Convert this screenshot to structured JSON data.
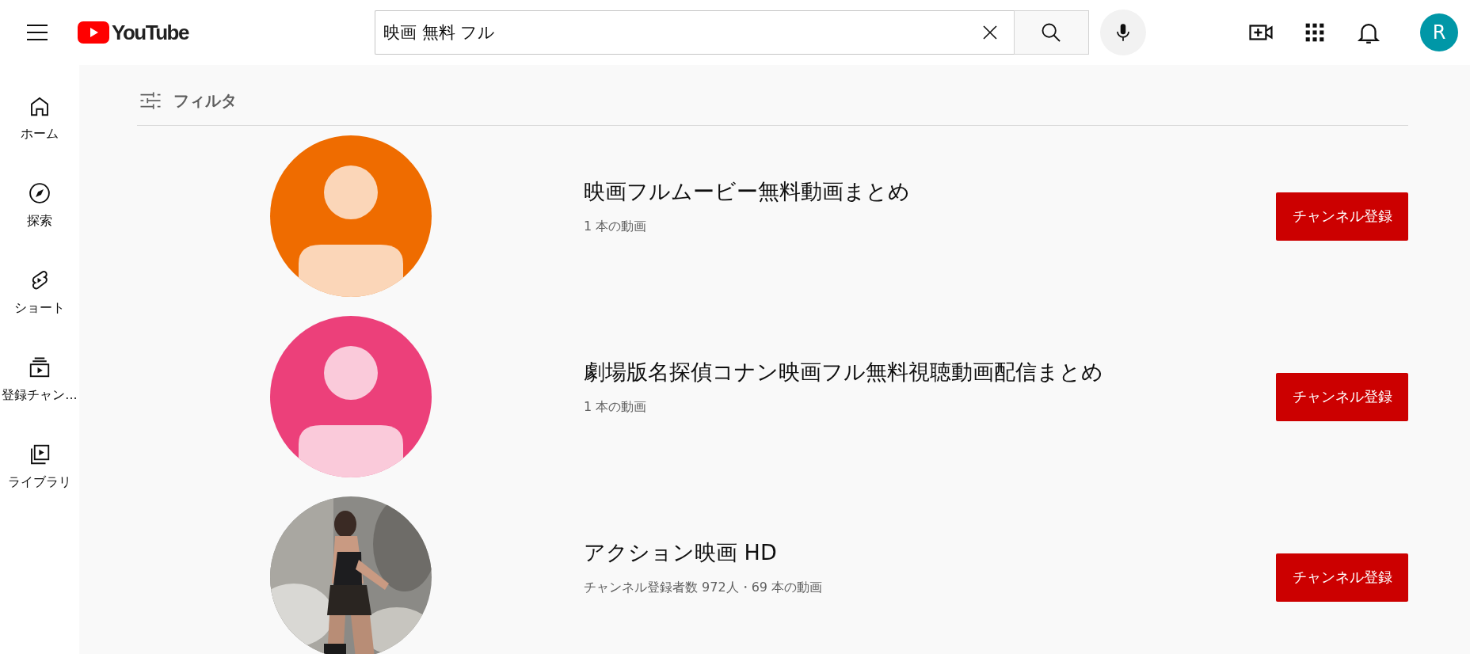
{
  "header": {
    "logo": "YouTube",
    "search": {
      "value": "映画 無料 フル"
    },
    "account": {
      "initial": "R",
      "color": "#0097a7"
    }
  },
  "sidebar": {
    "items": [
      {
        "label": "ホーム",
        "kind": "home"
      },
      {
        "label": "探索",
        "kind": "explore"
      },
      {
        "label": "ショート",
        "kind": "shorts"
      },
      {
        "label": "登録チャン...",
        "kind": "subscriptions"
      },
      {
        "label": "ライブラリ",
        "kind": "library"
      }
    ]
  },
  "filter": {
    "label": "フィルタ"
  },
  "results": [
    {
      "title": "映画フルムービー無料動画まとめ",
      "meta": "1 本の動画",
      "button": "チャンネル登録",
      "avatar": {
        "kind": "default",
        "color": "#ef6c00"
      }
    },
    {
      "title": "劇場版名探偵コナン映画フル無料視聴動画配信まとめ",
      "meta": "1 本の動画",
      "button": "チャンネル登録",
      "avatar": {
        "kind": "default",
        "color": "#ec407a"
      }
    },
    {
      "title": "アクション映画 HD",
      "meta": "チャンネル登録者数 972人・69 本の動画",
      "button": "チャンネル登録"
    }
  ]
}
